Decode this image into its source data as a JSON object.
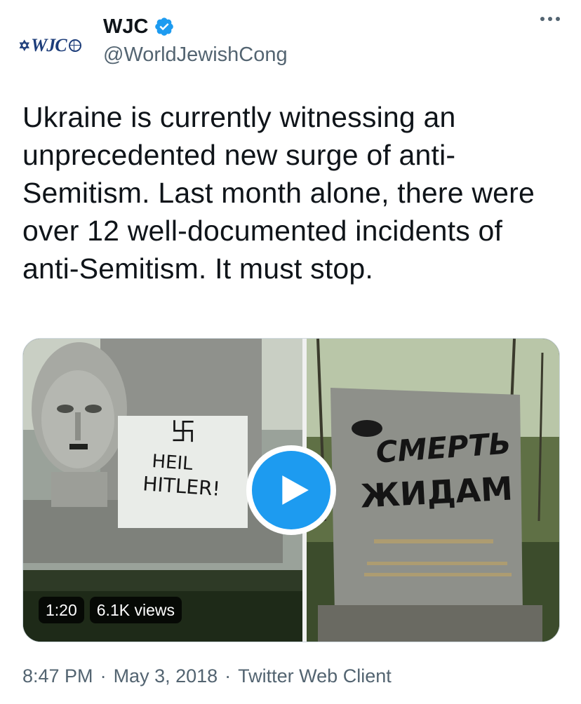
{
  "author": {
    "display_name": "WJC",
    "handle": "@WorldJewishCong",
    "avatar_text": "WJC",
    "verified_icon": "verified-badge-icon",
    "verified_color": "#1d9bf0"
  },
  "more_icon": "more-options-icon",
  "tweet": {
    "text": "Ukraine is currently witnessing an unprecedented new surge of anti-Semitism. Last month alone, there were over 12 well-documented incidents of anti-Semitism. It must stop."
  },
  "media": {
    "type": "video",
    "duration": "1:20",
    "views": "6.1K views",
    "play_icon": "play-icon",
    "play_color": "#1d9bf0",
    "left_graffiti": "HEIL HITLER!",
    "right_graffiti": "СМЕРТЬ ЖИДАМ"
  },
  "footer": {
    "time": "8:47 PM",
    "separator": "·",
    "date": "May 3, 2018",
    "client": "Twitter Web Client"
  }
}
